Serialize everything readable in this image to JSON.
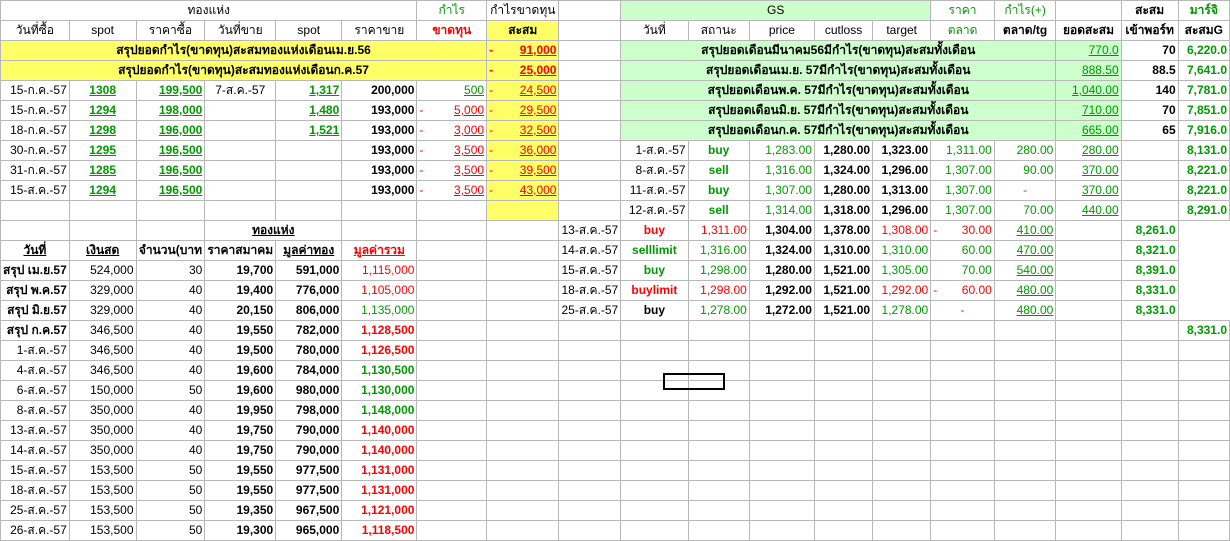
{
  "colors": {
    "yellow": "#ffff66",
    "green_fill": "#ccffcc",
    "green_text": "#009900",
    "red_text": "#ff0000"
  },
  "left_header1": {
    "group": "ทองแห่ง",
    "profit": "กำไร",
    "cum_profit": "กำไรขาดทุน"
  },
  "left_header2": {
    "buy_date": "วันที่ซื้อ",
    "spot": "spot",
    "buy_price": "ราคาซื้อ",
    "sell_date": "วันที่ขาย",
    "spot2": "spot",
    "sell_price": "ราคาขาย",
    "loss": "ขาดทุน",
    "cum": "สะสม"
  },
  "left_summary": [
    {
      "label": "สรุปยอดกำไร(ขาดทุน)สะสมทองแห่งเดือนเม.ย.56",
      "value": "91,000"
    },
    {
      "label": "สรุปยอดกำไร(ขาดทุน)สะสมทองแห่งเดือนก.ค.57",
      "value": "25,000"
    }
  ],
  "trades": [
    {
      "d": "15-ก.ค.-57",
      "spot": "1308",
      "buy": "199,500",
      "sd": "7-ส.ค.-57",
      "spot2": "1,317",
      "sell": "200,000",
      "pl": "500",
      "cum": "24,500"
    },
    {
      "d": "15-ก.ค.-57",
      "spot": "1294",
      "buy": "198,000",
      "sd": "",
      "spot2": "1,480",
      "sell": "193,000",
      "pl": "5,000",
      "cum": "29,500"
    },
    {
      "d": "18-ก.ค.-57",
      "spot": "1298",
      "buy": "196,000",
      "sd": "",
      "spot2": "1,521",
      "sell": "193,000",
      "pl": "3,000",
      "cum": "32,500"
    },
    {
      "d": "30-ก.ค.-57",
      "spot": "1295",
      "buy": "196,500",
      "sd": "",
      "spot2": "",
      "sell": "193,000",
      "pl": "3,500",
      "cum": "36,000"
    },
    {
      "d": "31-ก.ค.-57",
      "spot": "1285",
      "buy": "196,500",
      "sd": "",
      "spot2": "",
      "sell": "193,000",
      "pl": "3,500",
      "cum": "39,500"
    },
    {
      "d": "15-ส.ค.-57",
      "spot": "1294",
      "buy": "196,500",
      "sd": "",
      "spot2": "",
      "sell": "193,000",
      "pl": "3,500",
      "cum": "43,000"
    }
  ],
  "bar_header": {
    "title": "ทองแห่ง",
    "date": "วันที่",
    "cash": "เงินสด",
    "qty": "จำนวน(บาท",
    "assoc": "ราคาสมาคม",
    "value": "มูลค่าทอง",
    "total": "มูลค่ารวม"
  },
  "bar_rows": [
    {
      "d": "สรุป เม.ย.57",
      "cash": "524,000",
      "q": "30",
      "p": "19,700",
      "v": "591,000",
      "t": "1,115,000",
      "tc": "red",
      "s": true
    },
    {
      "d": "สรุป พ.ค.57",
      "cash": "329,000",
      "q": "40",
      "p": "19,400",
      "v": "776,000",
      "t": "1,105,000",
      "tc": "red",
      "s": true
    },
    {
      "d": "สรุป มิ.ย.57",
      "cash": "329,000",
      "q": "40",
      "p": "20,150",
      "v": "806,000",
      "t": "1,135,000",
      "tc": "green",
      "s": true
    },
    {
      "d": "สรุป ก.ค.57",
      "cash": "346,500",
      "q": "40",
      "p": "19,550",
      "v": "782,000",
      "t": "1,128,500",
      "tc": "red",
      "s": true
    },
    {
      "d": "1-ส.ค.-57",
      "cash": "346,500",
      "q": "40",
      "p": "19,500",
      "v": "780,000",
      "t": "1,126,500",
      "tc": "red"
    },
    {
      "d": "4-ส.ค.-57",
      "cash": "346,500",
      "q": "40",
      "p": "19,600",
      "v": "784,000",
      "t": "1,130,500",
      "tc": "green"
    },
    {
      "d": "6-ส.ค.-57",
      "cash": "150,000",
      "q": "50",
      "p": "19,600",
      "v": "980,000",
      "t": "1,130,000",
      "tc": "green"
    },
    {
      "d": "8-ส.ค.-57",
      "cash": "350,000",
      "q": "40",
      "p": "19,950",
      "v": "798,000",
      "t": "1,148,000",
      "tc": "green"
    },
    {
      "d": "13-ส.ค.-57",
      "cash": "350,000",
      "q": "40",
      "p": "19,750",
      "v": "790,000",
      "t": "1,140,000",
      "tc": "red"
    },
    {
      "d": "14-ส.ค.-57",
      "cash": "350,000",
      "q": "40",
      "p": "19,750",
      "v": "790,000",
      "t": "1,140,000",
      "tc": "red"
    },
    {
      "d": "15-ส.ค.-57",
      "cash": "153,500",
      "q": "50",
      "p": "19,550",
      "v": "977,500",
      "t": "1,131,000",
      "tc": "red"
    },
    {
      "d": "18-ส.ค.-57",
      "cash": "153,500",
      "q": "50",
      "p": "19,550",
      "v": "977,500",
      "t": "1,131,000",
      "tc": "red"
    },
    {
      "d": "25-ส.ค.-57",
      "cash": "153,500",
      "q": "50",
      "p": "19,350",
      "v": "967,500",
      "t": "1,121,000",
      "tc": "red"
    },
    {
      "d": "26-ส.ค.-57",
      "cash": "153,500",
      "q": "50",
      "p": "19,300",
      "v": "965,000",
      "t": "1,118,500",
      "tc": "red"
    }
  ],
  "right_header1": {
    "gs": "GS",
    "price": "ราคา",
    "profit": "กำไร(+)",
    "cum": "สะสม",
    "margin": "มาร์จิ"
  },
  "right_header2": {
    "date": "วันที่",
    "status": "สถานะ",
    "price": "price",
    "cutloss": "cutloss",
    "target": "target",
    "market": "ตลาด",
    "market_tg": "ตลาด/tg",
    "cum_total": "ยอดสะสม",
    "ports": "เข้าพอร์ท",
    "cum_g": "สะสมG"
  },
  "gs_summary": [
    {
      "label": "สรุปยอดเดือนมีนาคม56มีกำไร(ขาดทุน)สะสมทั้งเดือน",
      "value": "770.0",
      "port": "70",
      "g": "6,220.0"
    },
    {
      "label": "สรุปยอดเดือนเม.ย. 57มีกำไร(ขาดทุน)สะสมทั้งเดือน",
      "value": "888.50",
      "port": "88.5",
      "g": "7,641.0"
    },
    {
      "label": "สรุปยอดเดือนพ.ค. 57มีกำไร(ขาดทุน)สะสมทั้งเดือน",
      "value": "1,040.00",
      "port": "140",
      "g": "7,781.0"
    },
    {
      "label": "สรุปยอดเดือนมิ.ย. 57มีกำไร(ขาดทุน)สะสมทั้งเดือน",
      "value": "710.00",
      "port": "70",
      "g": "7,851.0"
    },
    {
      "label": "สรุปยอดเดือนก.ค. 57มีกำไร(ขาดทุน)สะสมทั้งเดือน",
      "value": "665.00",
      "port": "65",
      "g": "7,916.0"
    }
  ],
  "gs_trades": [
    {
      "d": "1-ส.ค.-57",
      "st": "buy",
      "c": "green",
      "price": "1,283.00",
      "cut": "1,280.00",
      "tg": "1,323.00",
      "mkt": "1,311.00",
      "mtg": "280.00",
      "cum": "280.00",
      "g": "8,131.0"
    },
    {
      "d": "8-ส.ค.-57",
      "st": "sell",
      "c": "green",
      "price": "1,316.00",
      "cut": "1,324.00",
      "tg": "1,296.00",
      "mkt": "1,307.00",
      "mtg": "90.00",
      "cum": "370.00",
      "g": "8,221.0"
    },
    {
      "d": "11-ส.ค.-57",
      "st": "buy",
      "c": "green",
      "price": "1,307.00",
      "cut": "1,280.00",
      "tg": "1,313.00",
      "mkt": "1,307.00",
      "mtg": "-",
      "cum": "370.00",
      "g": "8,221.0"
    },
    {
      "d": "12-ส.ค.-57",
      "st": "sell",
      "c": "green",
      "price": "1,314.00",
      "cut": "1,318.00",
      "tg": "1,296.00",
      "mkt": "1,307.00",
      "mtg": "70.00",
      "cum": "440.00",
      "g": "8,291.0"
    },
    {
      "d": "13-ส.ค.-57",
      "st": "buy",
      "c": "red",
      "price": "1,311.00",
      "cut": "1,304.00",
      "tg": "1,378.00",
      "mkt": "1,308.00",
      "mtg": "30.00",
      "cum": "410.00",
      "g": "8,261.0",
      "neg": true
    },
    {
      "d": "14-ส.ค.-57",
      "st": "selllimit",
      "c": "green",
      "price": "1,316.00",
      "cut": "1,324.00",
      "tg": "1,310.00",
      "mkt": "1,310.00",
      "mtg": "60.00",
      "cum": "470.00",
      "g": "8,321.0"
    },
    {
      "d": "15-ส.ค.-57",
      "st": "buy",
      "c": "green",
      "price": "1,298.00",
      "cut": "1,280.00",
      "tg": "1,521.00",
      "mkt": "1,305.00",
      "mtg": "70.00",
      "cum": "540.00",
      "g": "8,391.0"
    },
    {
      "d": "18-ส.ค.-57",
      "st": "buylimit",
      "c": "red",
      "price": "1,298.00",
      "cut": "1,292.00",
      "tg": "1,521.00",
      "mkt": "1,292.00",
      "mtg": "60.00",
      "cum": "480.00",
      "g": "8,331.0",
      "neg": true
    },
    {
      "d": "25-ส.ค.-57",
      "st": "buy",
      "c": "black",
      "price": "1,278.00",
      "cut": "1,272.00",
      "tg": "1,521.00",
      "mkt": "1,278.00",
      "mtg": "-",
      "cum": "480.00",
      "g": "8,331.0"
    }
  ],
  "trailing_g": "8,331.0"
}
